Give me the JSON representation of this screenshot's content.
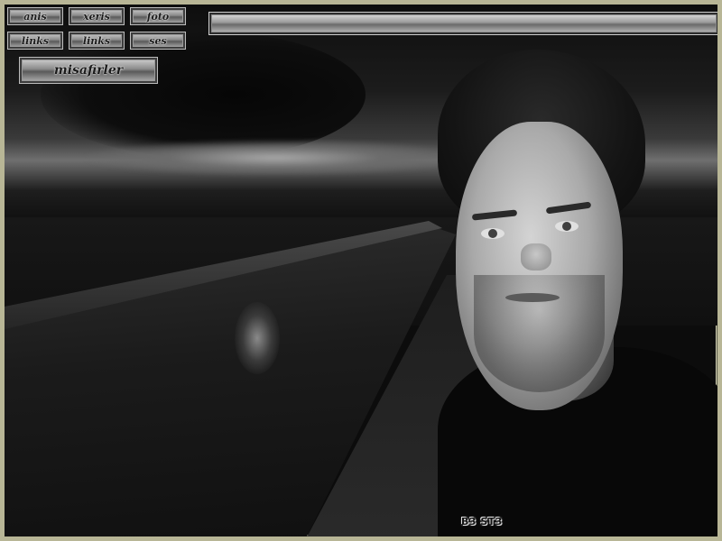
{
  "nav": {
    "row1": [
      "anis",
      "xeris",
      "foto"
    ],
    "row2": [
      "links",
      "links",
      "ses"
    ],
    "main_label": "misafirler"
  },
  "signature": "B3 ST3",
  "colors": {
    "frame": "#b8b696",
    "button_light": "#d8d8d8",
    "button_dark": "#5a5a5a"
  }
}
